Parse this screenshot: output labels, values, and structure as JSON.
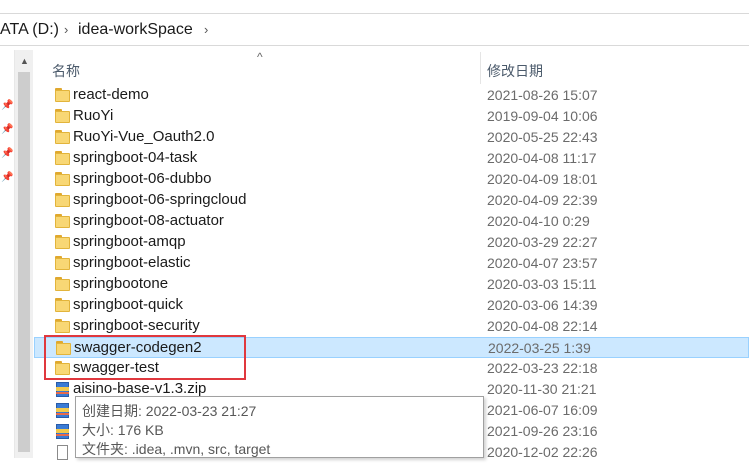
{
  "address_bar": {
    "crumbs": [
      "ATA (D:)",
      "idea-workSpace"
    ],
    "separator": "›"
  },
  "columns": {
    "name": "名称",
    "modified": "修改日期"
  },
  "files": [
    {
      "name": "react-demo",
      "modified": "2021-08-26 15:07",
      "type": "folder"
    },
    {
      "name": "RuoYi",
      "modified": "2019-09-04 10:06",
      "type": "folder"
    },
    {
      "name": "RuoYi-Vue_Oauth2.0",
      "modified": "2020-05-25 22:43",
      "type": "folder"
    },
    {
      "name": "springboot-04-task",
      "modified": "2020-04-08 11:17",
      "type": "folder"
    },
    {
      "name": "springboot-06-dubbo",
      "modified": "2020-04-09 18:01",
      "type": "folder"
    },
    {
      "name": "springboot-06-springcloud",
      "modified": "2020-04-09 22:39",
      "type": "folder"
    },
    {
      "name": "springboot-08-actuator",
      "modified": "2020-04-10 0:29",
      "type": "folder"
    },
    {
      "name": "springboot-amqp",
      "modified": "2020-03-29 22:27",
      "type": "folder"
    },
    {
      "name": "springboot-elastic",
      "modified": "2020-04-07 23:57",
      "type": "folder"
    },
    {
      "name": "springbootone",
      "modified": "2020-03-03 15:11",
      "type": "folder"
    },
    {
      "name": "springboot-quick",
      "modified": "2020-03-06 14:39",
      "type": "folder"
    },
    {
      "name": "springboot-security",
      "modified": "2020-04-08 22:14",
      "type": "folder"
    },
    {
      "name": "swagger-codegen2",
      "modified": "2022-03-25 1:39",
      "type": "folder",
      "selected": true
    },
    {
      "name": "swagger-test",
      "modified": "2022-03-23 22:18",
      "type": "folder"
    },
    {
      "name": "aisino-base-v1.3.zip",
      "modified": "2020-11-30 21:21",
      "type": "zip"
    },
    {
      "name": "",
      "modified": "2021-06-07 16:09",
      "type": "zip"
    },
    {
      "name": "",
      "modified": "2021-09-26 23:16",
      "type": "zip"
    },
    {
      "name": "",
      "modified": "2020-12-02 22:26",
      "type": "file"
    }
  ],
  "tooltip": {
    "created": "创建日期: 2022-03-23 21:27",
    "size": "大小: 176 KB",
    "contents": "文件夹: .idea, .mvn, src, target"
  },
  "colors": {
    "selection_bg": "#cce8ff",
    "highlight_box": "#e0383e",
    "folder": "#f8d775"
  }
}
